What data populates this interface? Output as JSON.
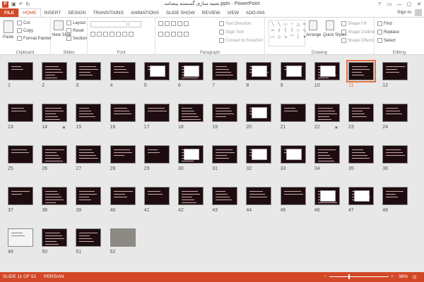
{
  "window": {
    "title": "شبیه سازی گسسته پیشامد.pptx - PowerPoint",
    "controls": [
      "?",
      "▭",
      "—",
      "▢",
      "✕"
    ]
  },
  "qat": {
    "logo": "P",
    "undo": "↶",
    "redo": "↻",
    "save": "▣"
  },
  "tabs": [
    "FILE",
    "HOME",
    "INSERT",
    "DESIGN",
    "TRANSITIONS",
    "ANIMATIONS",
    "SLIDE SHOW",
    "REVIEW",
    "VIEW",
    "ADD-INS"
  ],
  "active_tab": "HOME",
  "signin": "Sign in",
  "ribbon": {
    "clipboard": {
      "label": "Clipboard",
      "paste": "Paste",
      "cut": "Cut",
      "copy": "Copy",
      "format_painter": "Format Painter"
    },
    "slides": {
      "label": "Slides",
      "new_slide": "New Slide",
      "layout": "Layout",
      "reset": "Reset",
      "section": "Section"
    },
    "font": {
      "label": "Font"
    },
    "paragraph": {
      "label": "Paragraph",
      "text_direction": "Text Direction",
      "align_text": "Align Text",
      "convert": "Convert to SmartArt"
    },
    "drawing": {
      "label": "Drawing",
      "arrange": "Arrange",
      "quick_styles": "Quick Styles",
      "shape_fill": "Shape Fill",
      "shape_outline": "Shape Outline",
      "shape_effects": "Shape Effects"
    },
    "editing": {
      "label": "Editing",
      "find": "Find",
      "replace": "Replace",
      "select": "Select"
    }
  },
  "slides": [
    {
      "n": "1",
      "style": "dark"
    },
    {
      "n": "2",
      "style": "dark"
    },
    {
      "n": "3",
      "style": "dark"
    },
    {
      "n": "4",
      "style": "dark"
    },
    {
      "n": "5",
      "style": "dark"
    },
    {
      "n": "6",
      "style": "dark"
    },
    {
      "n": "7",
      "style": "dark"
    },
    {
      "n": "8",
      "style": "dark"
    },
    {
      "n": "9",
      "style": "dark"
    },
    {
      "n": "10",
      "style": "dark"
    },
    {
      "n": "11",
      "style": "dark",
      "selected": true
    },
    {
      "n": "12",
      "style": "dark"
    },
    {
      "n": "13",
      "style": "dark"
    },
    {
      "n": "14",
      "style": "dark",
      "star": true
    },
    {
      "n": "15",
      "style": "dark"
    },
    {
      "n": "16",
      "style": "dark"
    },
    {
      "n": "17",
      "style": "dark"
    },
    {
      "n": "18",
      "style": "dark"
    },
    {
      "n": "19",
      "style": "dark"
    },
    {
      "n": "20",
      "style": "dark"
    },
    {
      "n": "21",
      "style": "dark"
    },
    {
      "n": "22",
      "style": "dark",
      "star": true
    },
    {
      "n": "23",
      "style": "dark"
    },
    {
      "n": "24",
      "style": "dark"
    },
    {
      "n": "25",
      "style": "dark"
    },
    {
      "n": "26",
      "style": "dark"
    },
    {
      "n": "27",
      "style": "dark"
    },
    {
      "n": "28",
      "style": "dark"
    },
    {
      "n": "29",
      "style": "dark"
    },
    {
      "n": "30",
      "style": "dark"
    },
    {
      "n": "31",
      "style": "dark"
    },
    {
      "n": "32",
      "style": "dark"
    },
    {
      "n": "33",
      "style": "dark"
    },
    {
      "n": "34",
      "style": "dark"
    },
    {
      "n": "35",
      "style": "dark"
    },
    {
      "n": "36",
      "style": "dark"
    },
    {
      "n": "37",
      "style": "dark"
    },
    {
      "n": "38",
      "style": "dark"
    },
    {
      "n": "39",
      "style": "dark"
    },
    {
      "n": "40",
      "style": "dark"
    },
    {
      "n": "41",
      "style": "dark"
    },
    {
      "n": "42",
      "style": "dark"
    },
    {
      "n": "43",
      "style": "dark"
    },
    {
      "n": "44",
      "style": "dark"
    },
    {
      "n": "45",
      "style": "dark"
    },
    {
      "n": "46",
      "style": "dark"
    },
    {
      "n": "47",
      "style": "dark"
    },
    {
      "n": "48",
      "style": "dark"
    },
    {
      "n": "49",
      "style": "light"
    },
    {
      "n": "50",
      "style": "dark"
    },
    {
      "n": "51",
      "style": "dark"
    },
    {
      "n": "52",
      "style": "photo"
    }
  ],
  "status": {
    "slide_info": "SLIDE 11 OF 52",
    "language": "PERSIAN",
    "zoom": "38%",
    "zoom_minus": "−",
    "zoom_plus": "+",
    "fit": "⊡"
  },
  "colors": {
    "accent": "#d24726",
    "slide_bg": "#1e0d10",
    "selection": "#e7723f"
  }
}
